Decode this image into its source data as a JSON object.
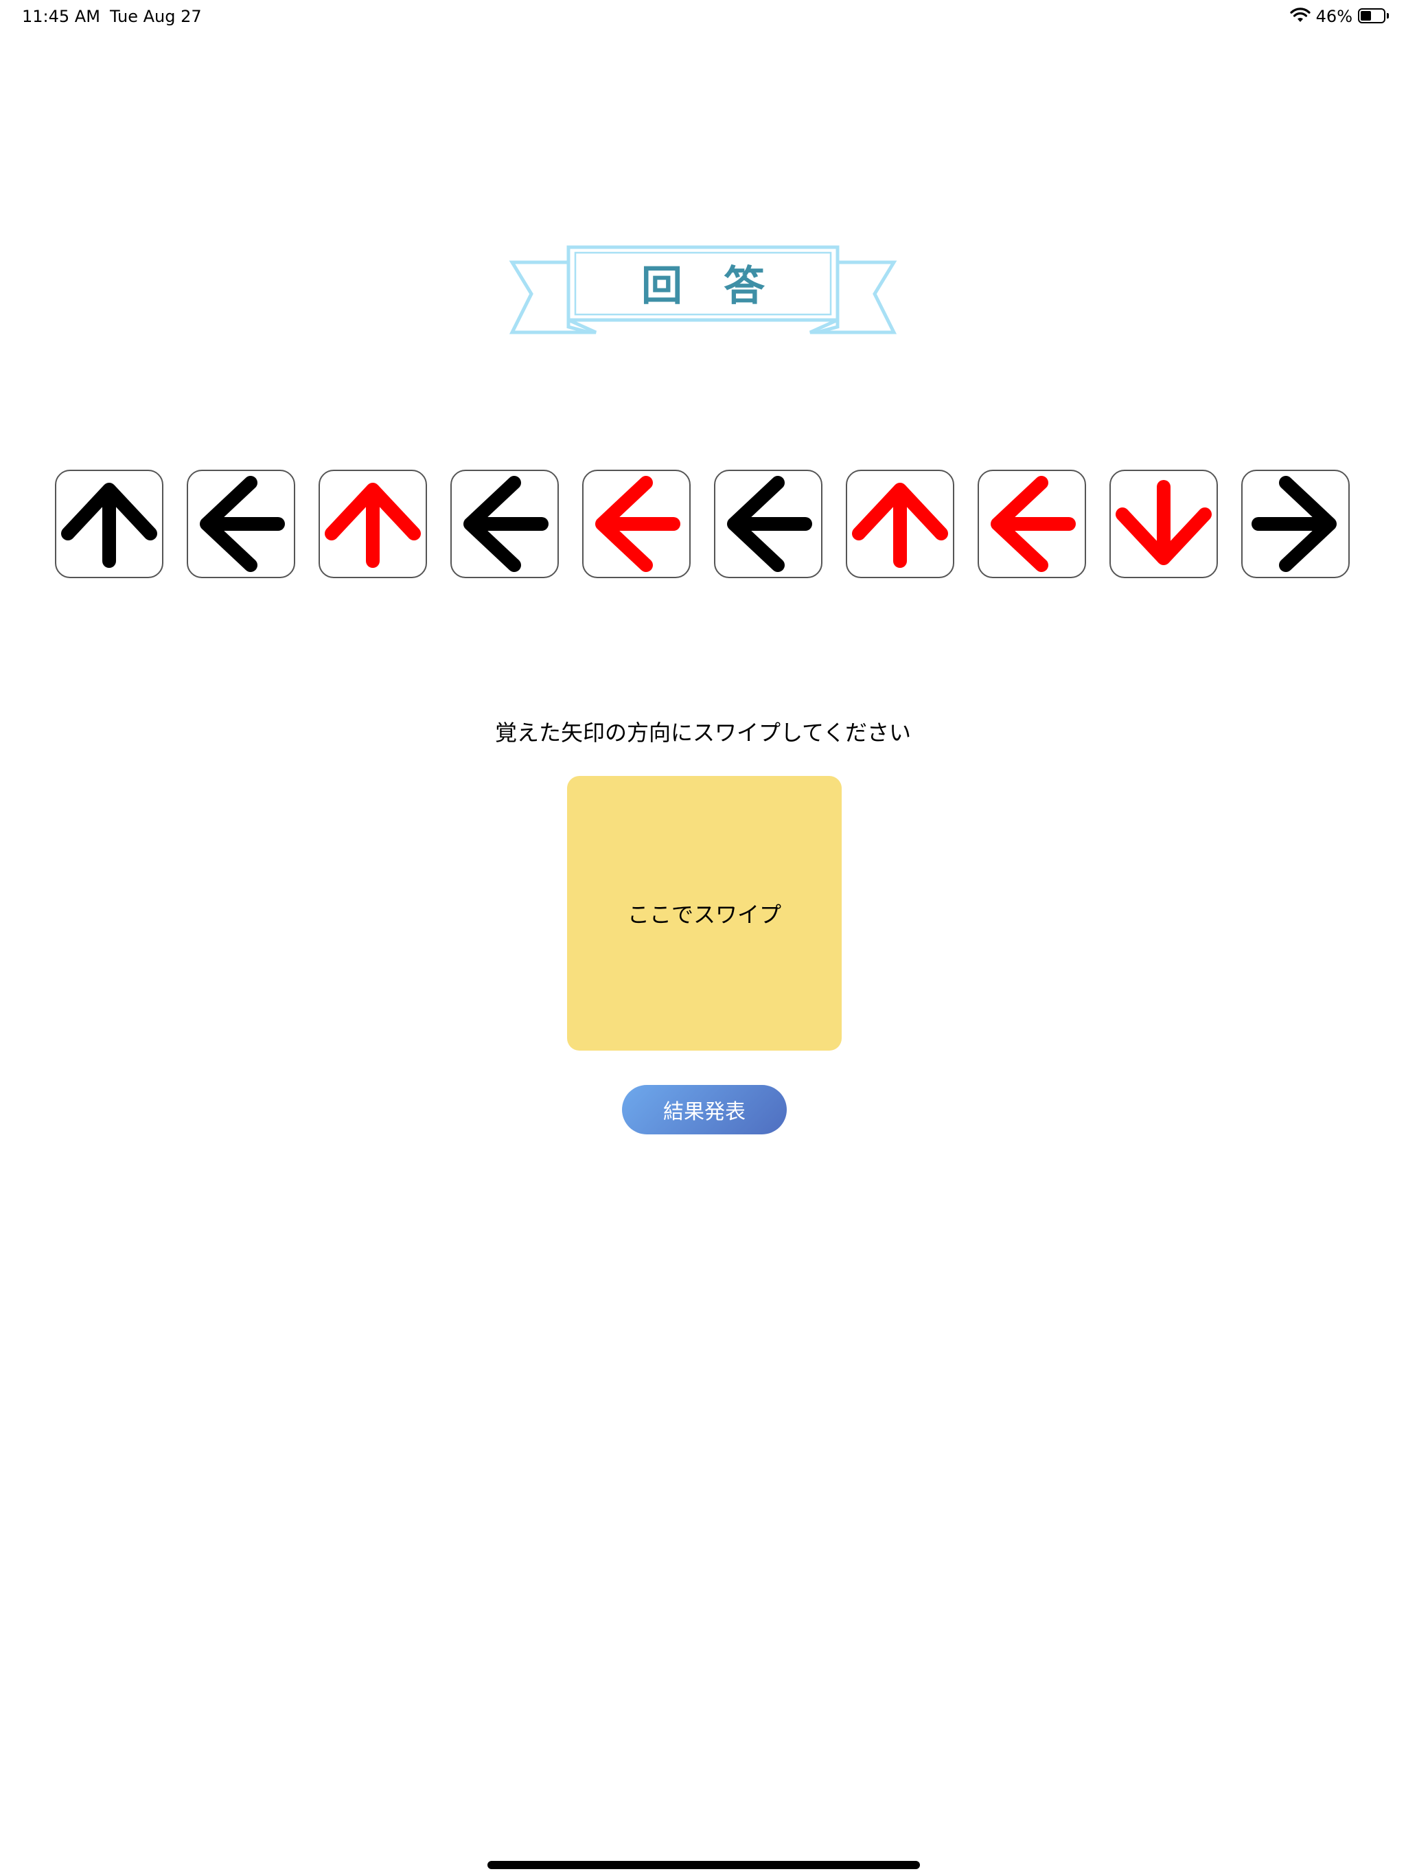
{
  "status_bar": {
    "time": "11:45 AM",
    "date": "Tue Aug 27",
    "battery_text": "46%",
    "battery_level": 0.46,
    "icons": [
      "wifi-icon",
      "battery-icon"
    ]
  },
  "header": {
    "title": "回答",
    "banner_color": "#a8e0f5",
    "title_color": "#3e8fa6"
  },
  "arrows": [
    {
      "direction": "up",
      "color": "black"
    },
    {
      "direction": "left",
      "color": "black"
    },
    {
      "direction": "up",
      "color": "red"
    },
    {
      "direction": "left",
      "color": "black"
    },
    {
      "direction": "left",
      "color": "red"
    },
    {
      "direction": "left",
      "color": "black"
    },
    {
      "direction": "up",
      "color": "red"
    },
    {
      "direction": "left",
      "color": "red"
    },
    {
      "direction": "down",
      "color": "red"
    },
    {
      "direction": "right",
      "color": "black"
    }
  ],
  "colors": {
    "black": "#000000",
    "red": "#ff0000",
    "swipe_pad": "#f8df7e",
    "button_start": "#6ea8ec",
    "button_end": "#4f6fc0"
  },
  "instruction": "覚えた矢印の方向にスワイプしてください",
  "swipe_pad": {
    "label": "ここでスワイプ"
  },
  "result_button": {
    "label": "結果発表"
  }
}
